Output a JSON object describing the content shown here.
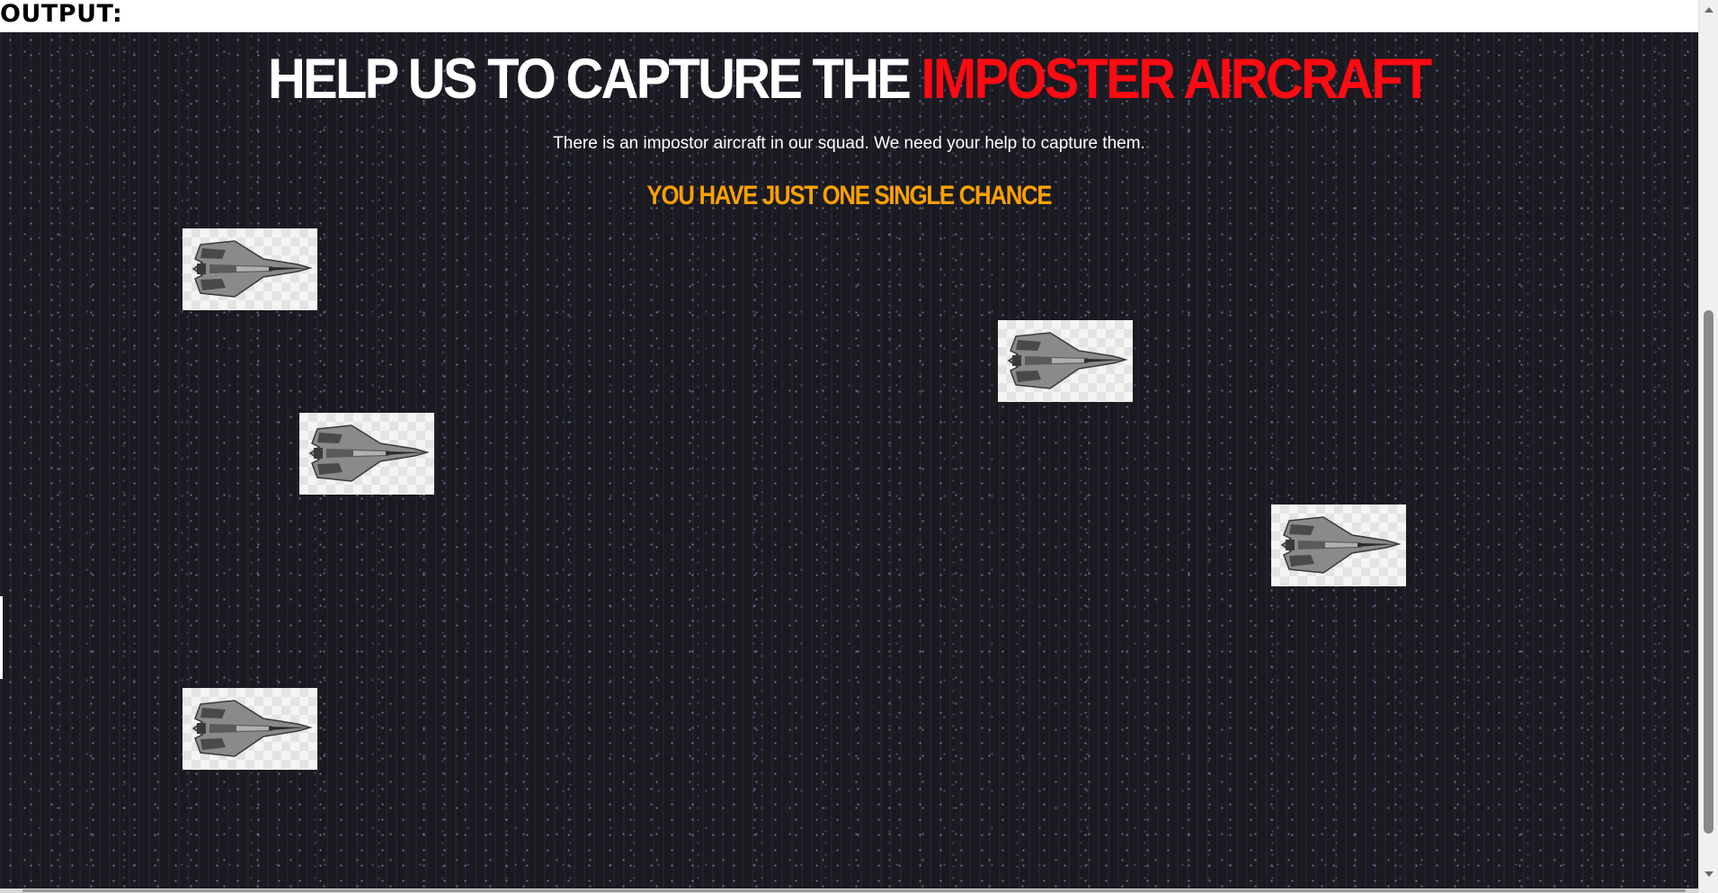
{
  "output_label": "OUTPUT:",
  "game": {
    "title_part1": "HELP US TO CAPTURE THE ",
    "title_part2": "IMPOSTER AIRCRAFT",
    "subtitle": "There is an impostor aircraft in our squad. We need your help to capture them.",
    "chance_text": "YOU HAVE JUST ONE SINGLE CHANCE",
    "aircraft_count": 5,
    "colors": {
      "background": "#1a1a20",
      "title_white": "#ffffff",
      "title_red": "#ff0a12",
      "chance_orange": "#ffa000"
    },
    "icons": [
      "fighter-jet-icon"
    ]
  }
}
